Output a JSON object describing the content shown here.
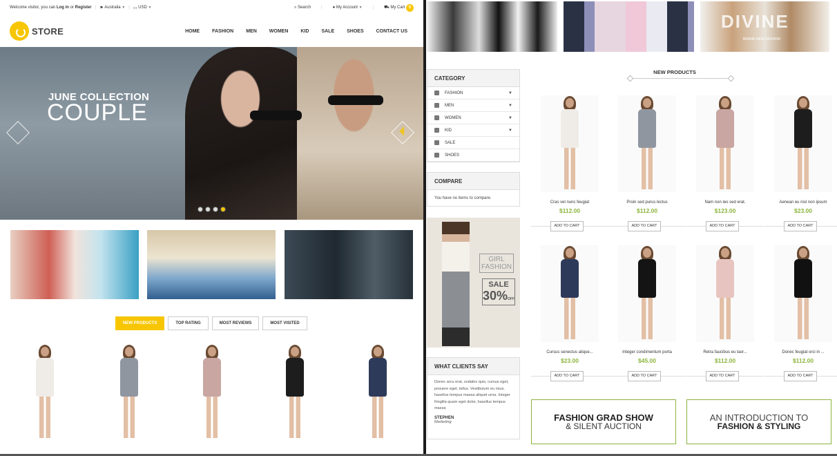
{
  "topbar": {
    "welcome": "Welcome visitor, you can",
    "login": "Log in",
    "or": "or",
    "register": "Register",
    "country": "Australia",
    "currency": "USD",
    "search": "Search",
    "account": "My Account",
    "cart": "My Cart",
    "cart_count": "0"
  },
  "logo": {
    "text": "STORE"
  },
  "nav": [
    "HOME",
    "FASHION",
    "MEN",
    "WOMEN",
    "KID",
    "SALE",
    "SHOES",
    "CONTACT US"
  ],
  "hero": {
    "subtitle": "JUNE COLLECTION",
    "title": "COUPLE",
    "slides": 4,
    "active_slide": 4
  },
  "tabs": [
    "NEW PRODUCTS",
    "TOP RATING",
    "MOST REVIEWS",
    "MOST VISITED"
  ],
  "active_tab": "NEW PRODUCTS",
  "right_top_banner": {
    "big_text": "DIVINE",
    "sub_text": "BRAND NEW FASHION"
  },
  "category": {
    "title": "CATEGORY",
    "items": [
      {
        "label": "FASHION",
        "icon": "gear-icon",
        "dropdown": true
      },
      {
        "label": "MEN",
        "icon": "man-icon",
        "dropdown": true
      },
      {
        "label": "WOMEN",
        "icon": "woman-icon",
        "dropdown": true
      },
      {
        "label": "KID",
        "icon": "child-icon",
        "dropdown": true
      },
      {
        "label": "SALE",
        "icon": "megaphone-icon",
        "dropdown": false
      },
      {
        "label": "SHOES",
        "icon": "gift-icon",
        "dropdown": false
      }
    ]
  },
  "compare": {
    "title": "COMPARE",
    "text": "You have no items to compare."
  },
  "promo": {
    "line1": "GIRL",
    "line2": "FASHION",
    "sale": "SALE",
    "percent": "30%",
    "off": "OFF"
  },
  "clients": {
    "title": "WHAT CLIENTS SAY",
    "text": "Donec arcu erat, sodales quis, cursus eget, posuere eget, tellus. Vestibulum eu risus. hasellus tempus massa aliquet urna. Integer fringilla quam eget dolor, hasellus tempus massa",
    "name": "STEPHEN",
    "role": "Marketing"
  },
  "new_products": {
    "title": "NEW PRODUCTS",
    "button_label": "ADD TO CART",
    "items": [
      {
        "name": "Cras vel nunc feugiat",
        "price": "$112.00",
        "dress": "#efebe6"
      },
      {
        "name": "Proin sed purus lectus",
        "price": "$112.00",
        "dress": "#8f96a0"
      },
      {
        "name": "Nam non leo sed erat.",
        "price": "$123.00",
        "dress": "#c9a6a2"
      },
      {
        "name": "Aenean eu nisl non ipsum",
        "price": "$23.00",
        "dress": "#1d1d1d"
      },
      {
        "name": "Cursus senectus alique...",
        "price": "$23.00",
        "dress": "#2e3a5a"
      },
      {
        "name": "Integer condimentum porta",
        "price": "$45.00",
        "dress": "#141414"
      },
      {
        "name": "Retra faucibus eu laor...",
        "price": "$112.00",
        "dress": "#e8c4c0"
      },
      {
        "name": "Donec feugiat orci in ...",
        "price": "$112.00",
        "dress": "#111111"
      }
    ]
  },
  "strip_dresses": [
    "#efebe6",
    "#8f96a0",
    "#c9a6a2",
    "#1d1d1d",
    "#2e3a5a"
  ],
  "bottom_promos": [
    {
      "line1": "FASHION GRAD SHOW",
      "line2": "& SILENT AUCTION"
    },
    {
      "line1": "AN INTRODUCTION TO",
      "line2": "FASHION & STYLING"
    }
  ],
  "colors": {
    "accent": "#f7c600",
    "price": "#8cb43d"
  }
}
